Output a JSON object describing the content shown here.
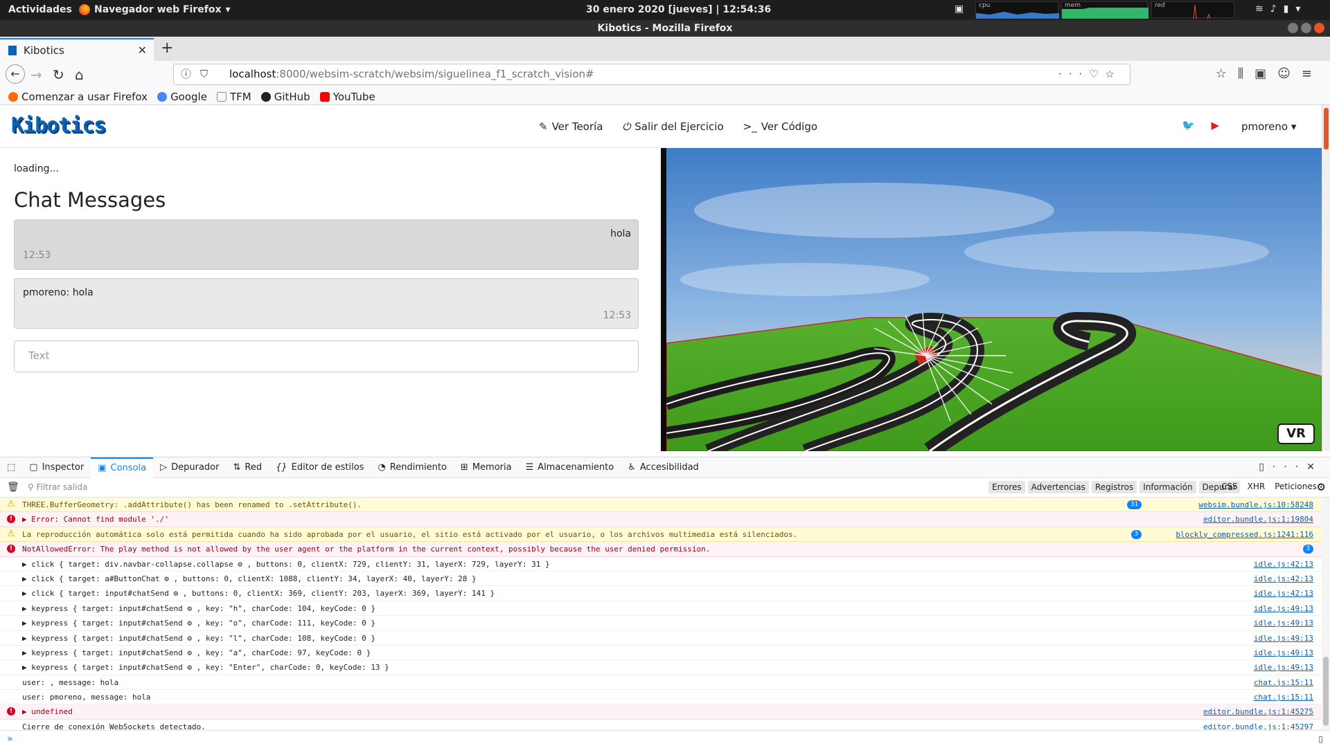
{
  "system": {
    "activities": "Actividades",
    "app_name": "Navegador web Firefox",
    "clock": "30 enero 2020 [jueves] | 12:54:36",
    "monitors": [
      "cpu",
      "mem",
      "red"
    ]
  },
  "window": {
    "title": "Kibotics - Mozilla Firefox"
  },
  "tab": {
    "title": "Kibotics"
  },
  "url": {
    "host": "localhost",
    "path": ":8000/websim-scratch/websim/siguelinea_f1_scratch_vision#"
  },
  "bookmarks": [
    {
      "label": "Comenzar a usar Firefox",
      "color": "#ff6a00"
    },
    {
      "label": "Google",
      "color": "#4285f4"
    },
    {
      "label": "TFM",
      "color": "#8a8a8a"
    },
    {
      "label": "GitHub",
      "color": "#222222"
    },
    {
      "label": "YouTube",
      "color": "#ff0000"
    }
  ],
  "site": {
    "logo": "Kibotics",
    "menu": [
      {
        "icon": "pencil-icon",
        "label": "Ver Teoría"
      },
      {
        "icon": "power-icon",
        "label": "Salir del Ejercicio"
      },
      {
        "icon": "terminal-icon",
        "label": "Ver Código"
      }
    ],
    "user": "pmoreno ▾"
  },
  "chat": {
    "loading": "loading...",
    "heading": "Chat Messages",
    "messages": [
      {
        "text": "hola",
        "time": "12:53"
      },
      {
        "text": "pmoreno: hola",
        "time": "12:53"
      }
    ],
    "placeholder": "Text"
  },
  "simulator": {
    "vr_label": "VR"
  },
  "devtools": {
    "tabs": [
      "Inspector",
      "Consola",
      "Depurador",
      "Red",
      "Editor de estilos",
      "Rendimiento",
      "Memoria",
      "Almacenamiento",
      "Accesibilidad"
    ],
    "filter_placeholder": "Filtrar salida",
    "filters": [
      "Errores",
      "Advertencias",
      "Registros",
      "Información",
      "Depurar"
    ],
    "filters2": [
      "CSS",
      "XHR",
      "Peticiones"
    ],
    "logs": [
      {
        "type": "warn",
        "msg": "THREE.BufferGeometry: .addAttribute() has been renamed to .setAttribute().",
        "src": "websim.bundle.js:10:58248",
        "badge": "31"
      },
      {
        "type": "err",
        "msg": "▶ Error: Cannot find module './'",
        "src": "editor.bundle.js:1:19804",
        "badge": ""
      },
      {
        "type": "warn",
        "msg": "La reproducción automática solo está permitida cuando ha sido aprobada por el usuario, el sitio está activado por el usuario, o los archivos multimedia está silenciados.",
        "src": "blockly_compressed.js:1241:116",
        "badge": "3"
      },
      {
        "type": "err",
        "msg": "NotAllowedError: The play method is not allowed by the user agent or the platform in the current context, possibly because the user denied permission.",
        "src": "",
        "badge": "3"
      },
      {
        "type": "log",
        "msg": "▶ click { target: div.navbar-collapse.collapse ⚙ , buttons: 0, clientX: 729, clientY: 31, layerX: 729, layerY: 31 }",
        "src": "idle.js:42:13",
        "badge": ""
      },
      {
        "type": "log",
        "msg": "▶ click { target: a#ButtonChat ⚙ , buttons: 0, clientX: 1088, clientY: 34, layerX: 40, layerY: 28 }",
        "src": "idle.js:42:13",
        "badge": ""
      },
      {
        "type": "log",
        "msg": "▶ click { target: input#chatSend ⚙ , buttons: 0, clientX: 369, clientY: 203, layerX: 369, layerY: 141 }",
        "src": "idle.js:42:13",
        "badge": ""
      },
      {
        "type": "log",
        "msg": "▶ keypress { target: input#chatSend ⚙ , key: \"h\", charCode: 104, keyCode: 0 }",
        "src": "idle.js:49:13",
        "badge": ""
      },
      {
        "type": "log",
        "msg": "▶ keypress { target: input#chatSend ⚙ , key: \"o\", charCode: 111, keyCode: 0 }",
        "src": "idle.js:49:13",
        "badge": ""
      },
      {
        "type": "log",
        "msg": "▶ keypress { target: input#chatSend ⚙ , key: \"l\", charCode: 108, keyCode: 0 }",
        "src": "idle.js:49:13",
        "badge": ""
      },
      {
        "type": "log",
        "msg": "▶ keypress { target: input#chatSend ⚙ , key: \"a\", charCode: 97, keyCode: 0 }",
        "src": "idle.js:49:13",
        "badge": ""
      },
      {
        "type": "log",
        "msg": "▶ keypress { target: input#chatSend ⚙ , key: \"Enter\", charCode: 0, keyCode: 13 }",
        "src": "idle.js:49:13",
        "badge": ""
      },
      {
        "type": "log",
        "msg": "user: , message: hola",
        "src": "chat.js:15:11",
        "badge": ""
      },
      {
        "type": "log",
        "msg": "user: pmoreno, message: hola",
        "src": "chat.js:15:11",
        "badge": ""
      },
      {
        "type": "err",
        "msg": "▶ undefined",
        "src": "editor.bundle.js:1:45275",
        "badge": ""
      },
      {
        "type": "log",
        "msg": "Cierre de conexión WebSockets detectado.",
        "src": "editor.bundle.js:1:45297",
        "badge": ""
      }
    ]
  }
}
